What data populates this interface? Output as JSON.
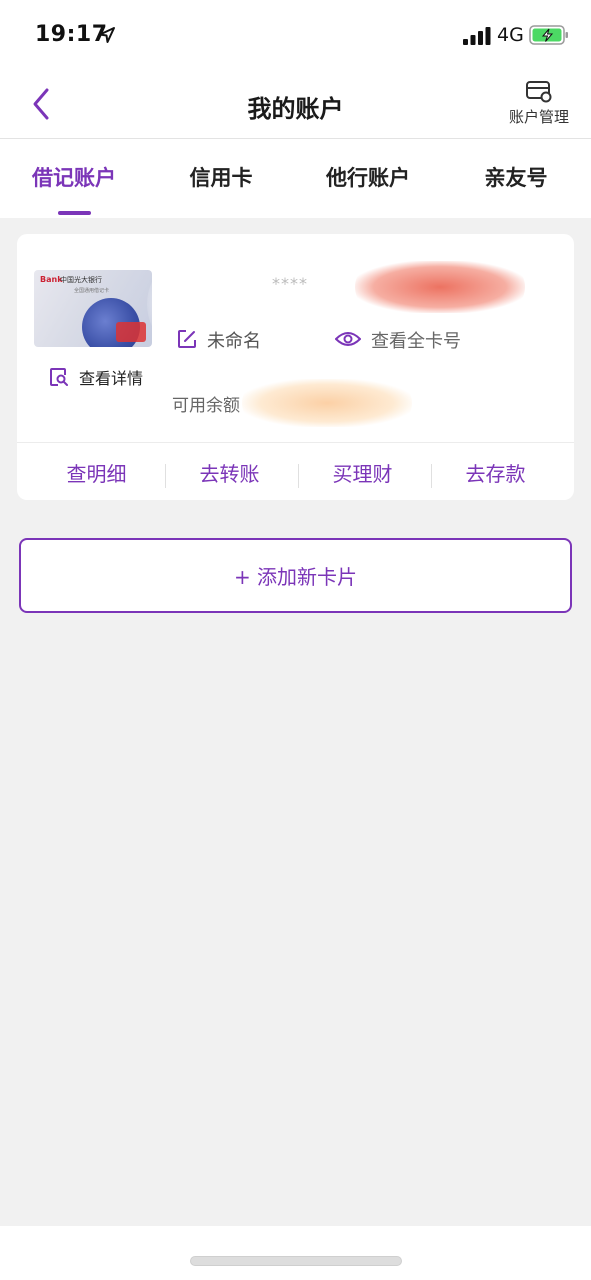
{
  "status_bar": {
    "time": "19:17",
    "network": "4G"
  },
  "navbar": {
    "title": "我的账户",
    "manage_label": "账户管理"
  },
  "tabs": [
    {
      "label": "借记账户",
      "active": true
    },
    {
      "label": "信用卡",
      "active": false
    },
    {
      "label": "他行账户",
      "active": false
    },
    {
      "label": "亲友号",
      "active": false
    }
  ],
  "account_card": {
    "bank_card_brand": "Bank",
    "bank_card_name": "中国光大银行",
    "bank_card_sub": "全国通用借记卡",
    "card_number_masked": "****",
    "rename_label": "未命名",
    "show_full_label": "查看全卡号",
    "details_label": "查看详情",
    "balance_label": "可用余额"
  },
  "card_actions": [
    "查明细",
    "去转账",
    "买理财",
    "去存款"
  ],
  "add_card_label": "+ 添加新卡片",
  "colors": {
    "accent": "#7b35b8",
    "background": "#f1f1f1"
  }
}
